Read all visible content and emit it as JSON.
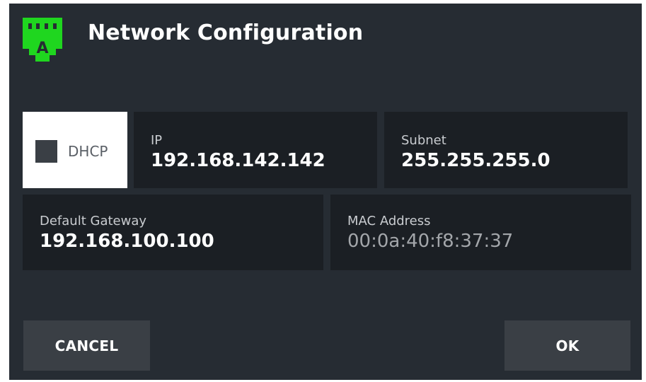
{
  "dialog": {
    "title": "Network Configuration",
    "icon": "ethernet-port-icon",
    "icon_letter": "A",
    "icon_color": "#1fd61f"
  },
  "dhcp": {
    "label": "DHCP",
    "checked": false
  },
  "fields": {
    "ip": {
      "label": "IP",
      "value": "192.168.142.142"
    },
    "subnet": {
      "label": "Subnet",
      "value": "255.255.255.0"
    },
    "gateway": {
      "label": "Default Gateway",
      "value": "192.168.100.100"
    },
    "mac": {
      "label": "MAC Address",
      "value": "00:0a:40:f8:37:37"
    }
  },
  "buttons": {
    "cancel": "CANCEL",
    "ok": "OK"
  },
  "colors": {
    "background": "#262c33",
    "tile": "#1b1f24",
    "button": "#3a3f45",
    "accent": "#1fd61f"
  }
}
